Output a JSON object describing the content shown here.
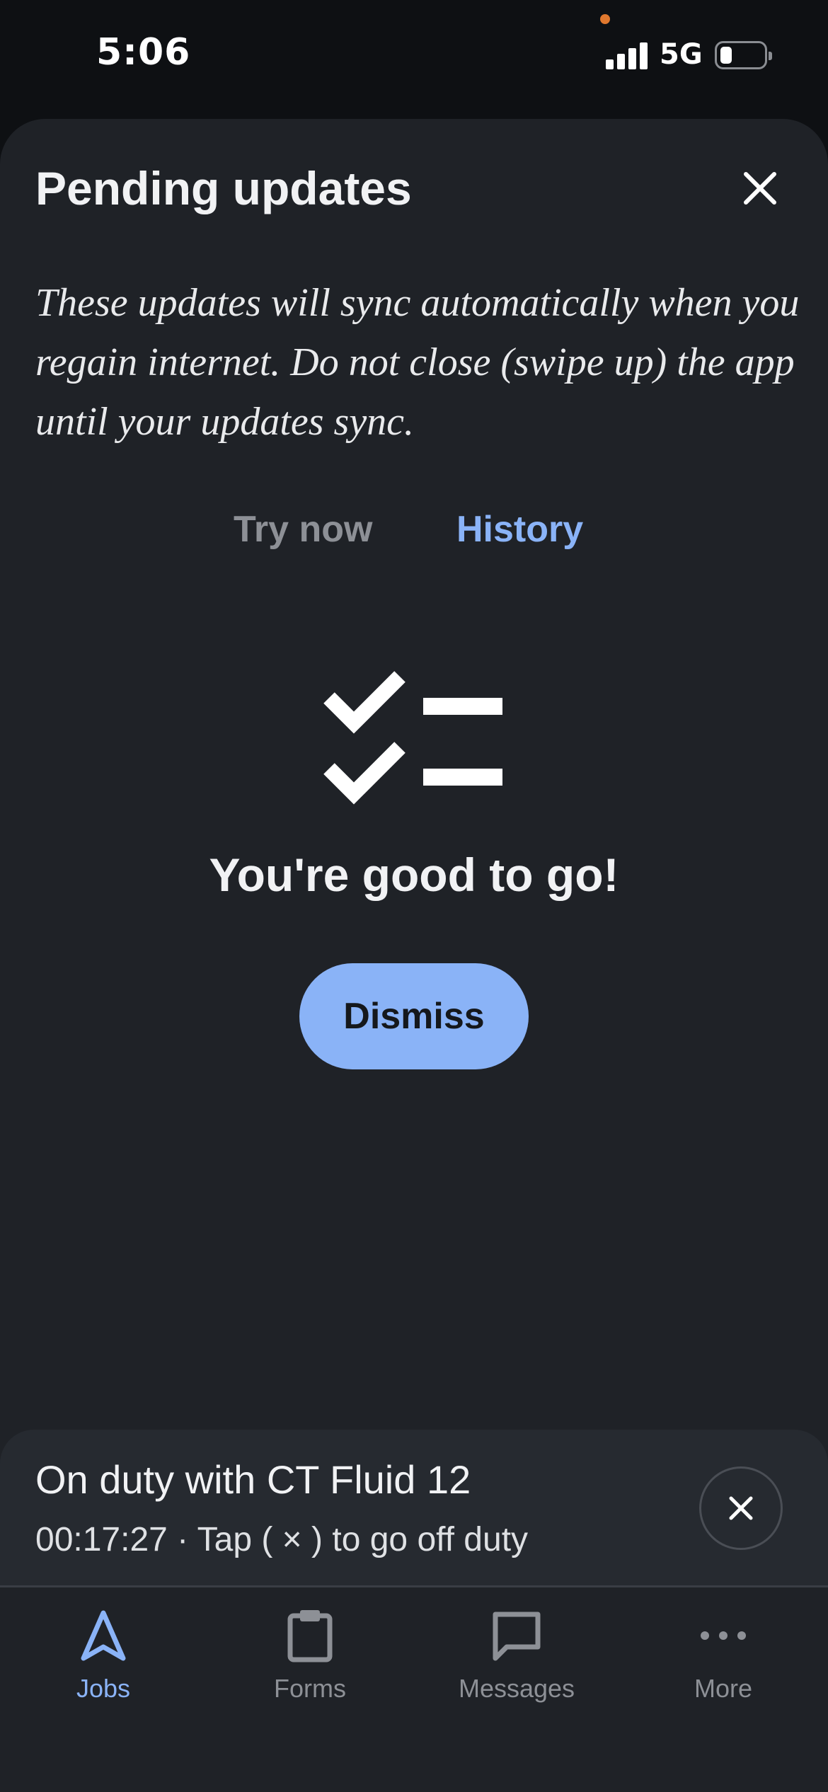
{
  "status_bar": {
    "time": "5:06",
    "network": "5G",
    "icons": [
      "signal-icon",
      "battery-icon"
    ]
  },
  "sheet": {
    "title": "Pending updates",
    "close_icon": "close-icon",
    "description": "These updates will sync automatically when you regain internet. Do not close (swipe up) the app until your updates sync.",
    "tabs": [
      {
        "label": "Try now",
        "active": false
      },
      {
        "label": "History",
        "active": true
      }
    ],
    "empty_state": {
      "icon": "checklist-icon",
      "message": "You're good to go!",
      "button_label": "Dismiss"
    }
  },
  "duty_bar": {
    "title": "On duty with CT Fluid 12",
    "subtitle": "00:17:27 · Tap ( × ) to go off duty",
    "close_icon": "close-icon"
  },
  "nav": {
    "items": [
      {
        "label": "Jobs",
        "icon": "navigation-arrow-icon",
        "active": true
      },
      {
        "label": "Forms",
        "icon": "clipboard-icon",
        "active": false
      },
      {
        "label": "Messages",
        "icon": "chat-bubble-icon",
        "active": false
      },
      {
        "label": "More",
        "icon": "more-dots-icon",
        "active": false
      }
    ]
  },
  "colors": {
    "background": "#1f2227",
    "accent": "#8ab3f7",
    "muted": "#8d9096",
    "status_dot": "#e0782e"
  }
}
